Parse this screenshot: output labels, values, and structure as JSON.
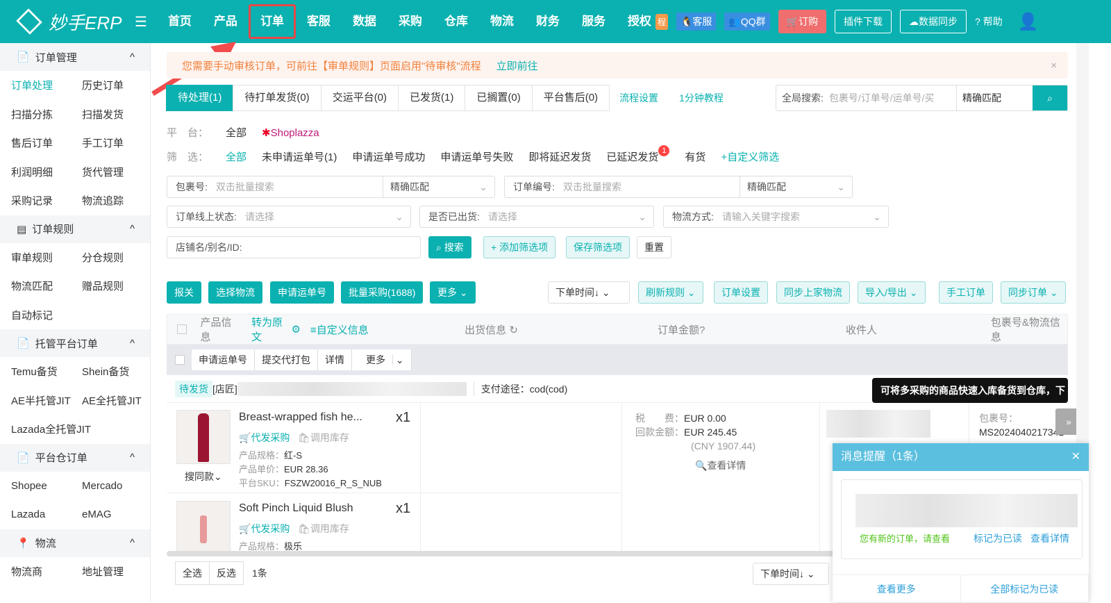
{
  "header": {
    "brand": "妙手ERP",
    "nav": [
      "首页",
      "产品",
      "订单",
      "客服",
      "数据",
      "采购",
      "仓库",
      "物流",
      "财务",
      "服务",
      "授权"
    ],
    "active_nav": "订单",
    "cheng_badge": "程",
    "kefu": "客服",
    "qq_group": "QQ群",
    "order_btn": "订购",
    "plugin_btn": "插件下载",
    "sync_btn": "数据同步",
    "help": "帮助"
  },
  "sidebar": {
    "groups": [
      {
        "title": "订单管理",
        "items": [
          "订单处理",
          "历史订单",
          "扫描分拣",
          "扫描发货",
          "售后订单",
          "手工订单",
          "利润明细",
          "货代管理",
          "采购记录",
          "物流追踪"
        ]
      },
      {
        "title": "订单规则",
        "items": [
          "审单规则",
          "分仓规则",
          "物流匹配",
          "赠品规则",
          "自动标记"
        ]
      },
      {
        "title": "托管平台订单",
        "items": [
          "Temu备货",
          "Shein备货",
          "AE半托管JIT",
          "AE全托管JIT",
          "Lazada全托管JIT"
        ]
      },
      {
        "title": "平台仓订单",
        "items": [
          "Shopee",
          "Mercado",
          "Lazada",
          "eMAG"
        ]
      },
      {
        "title": "物流",
        "items": [
          "物流商",
          "地址管理"
        ]
      }
    ],
    "active_item": "订单处理"
  },
  "notice": {
    "text": "您需要手动审核订单，可前往【审单规则】页面启用\"待审核\"流程",
    "link": "立即前往"
  },
  "tabs": [
    "待处理(1)",
    "待打单发货(0)",
    "交运平台(0)",
    "已发货(1)",
    "已搁置(0)",
    "平台售后(0)"
  ],
  "links": {
    "flow": "流程设置",
    "tutorial": "1分钟教程"
  },
  "global_search": {
    "label": "全局搜索:",
    "placeholder": "包裹号/订单号/运单号/买",
    "match": "精确匹配"
  },
  "platform": {
    "label": "平　台：",
    "all": "全部",
    "shop": "Shoplazza"
  },
  "filter": {
    "label": "筛　选：",
    "items": [
      "全部",
      "未申请运单号(1)",
      "申请运单号成功",
      "申请运单号失败",
      "即将延迟发货",
      "已延迟发货",
      "有货"
    ],
    "delay_badge": "1",
    "custom": "+自定义筛选"
  },
  "fields": {
    "pkg_label": "包裹号:",
    "pkg_ph": "双击批量搜索",
    "match": "精确匹配",
    "order_label": "订单编号:",
    "order_ph": "双击批量搜索",
    "online_label": "订单线上状态:",
    "online_ph": "请选择",
    "shipped_label": "是否已出货:",
    "shipped_ph": "请选择",
    "logistics_label": "物流方式:",
    "logistics_ph": "请输入关键字搜索",
    "shop_ph": "店铺名/别名/ID:"
  },
  "filter_btns": {
    "search": "搜索",
    "add": "+ 添加筛选项",
    "save": "保存筛选项",
    "reset": "重置"
  },
  "actions": [
    "报关",
    "选择物流",
    "申请运单号",
    "批量采购(1688)",
    "更多"
  ],
  "right_actions": {
    "sort": "下单时间↓",
    "rules": "刷新规则",
    "settings": "订单设置",
    "sync_logistics": "同步上家物流",
    "import_export": "导入/导出",
    "manual": "手工订单",
    "sync": "同步订单"
  },
  "table": {
    "cols": [
      "产品信息",
      "转为原文",
      "自定义信息",
      "出货信息",
      "订单金额",
      "收件人",
      "包裹号&物流信息"
    ],
    "bulk": [
      "申请运单号",
      "提交代打包",
      "详情",
      "更多"
    ]
  },
  "order": {
    "status": "待发货",
    "shop": "[店匠]",
    "payment": "支付途径：cod(cod)",
    "tip": "可将多采购的商品快速入库备货到仓库，下",
    "products": [
      {
        "name": "Breast-wrapped fish he...",
        "qty": "x1",
        "spec": "红-S",
        "price": "EUR 28.36",
        "sku": "FSZW20016_R_S_NUB",
        "similar": "搜同款"
      },
      {
        "name": "Soft Pinch Liquid Blush",
        "qty": "x1",
        "spec": "极乐"
      }
    ],
    "buy": "代发采购",
    "stock": "调用库存",
    "spec_label": "产品规格：",
    "price_label": "产品单价：",
    "sku_label": "平台SKU：",
    "tax_label": "税　　费：",
    "tax": "EUR 0.00",
    "refund_label": "回款金额：",
    "refund": "EUR 245.45",
    "cny": "(CNY 1907.44)",
    "detail": "查看详情",
    "pkg_label": "包裹号：",
    "pkg_no": "MS2024040217341"
  },
  "footer": {
    "select_all": "全选",
    "invert": "反选",
    "count": "1条",
    "sort": "下单时间↓"
  },
  "popup": {
    "title": "消息提醒（1条）",
    "msg": "您有新的订单，请查看",
    "mark": "标记为已读",
    "detail": "查看详情",
    "more": "查看更多",
    "mark_all": "全部标记为已读"
  }
}
